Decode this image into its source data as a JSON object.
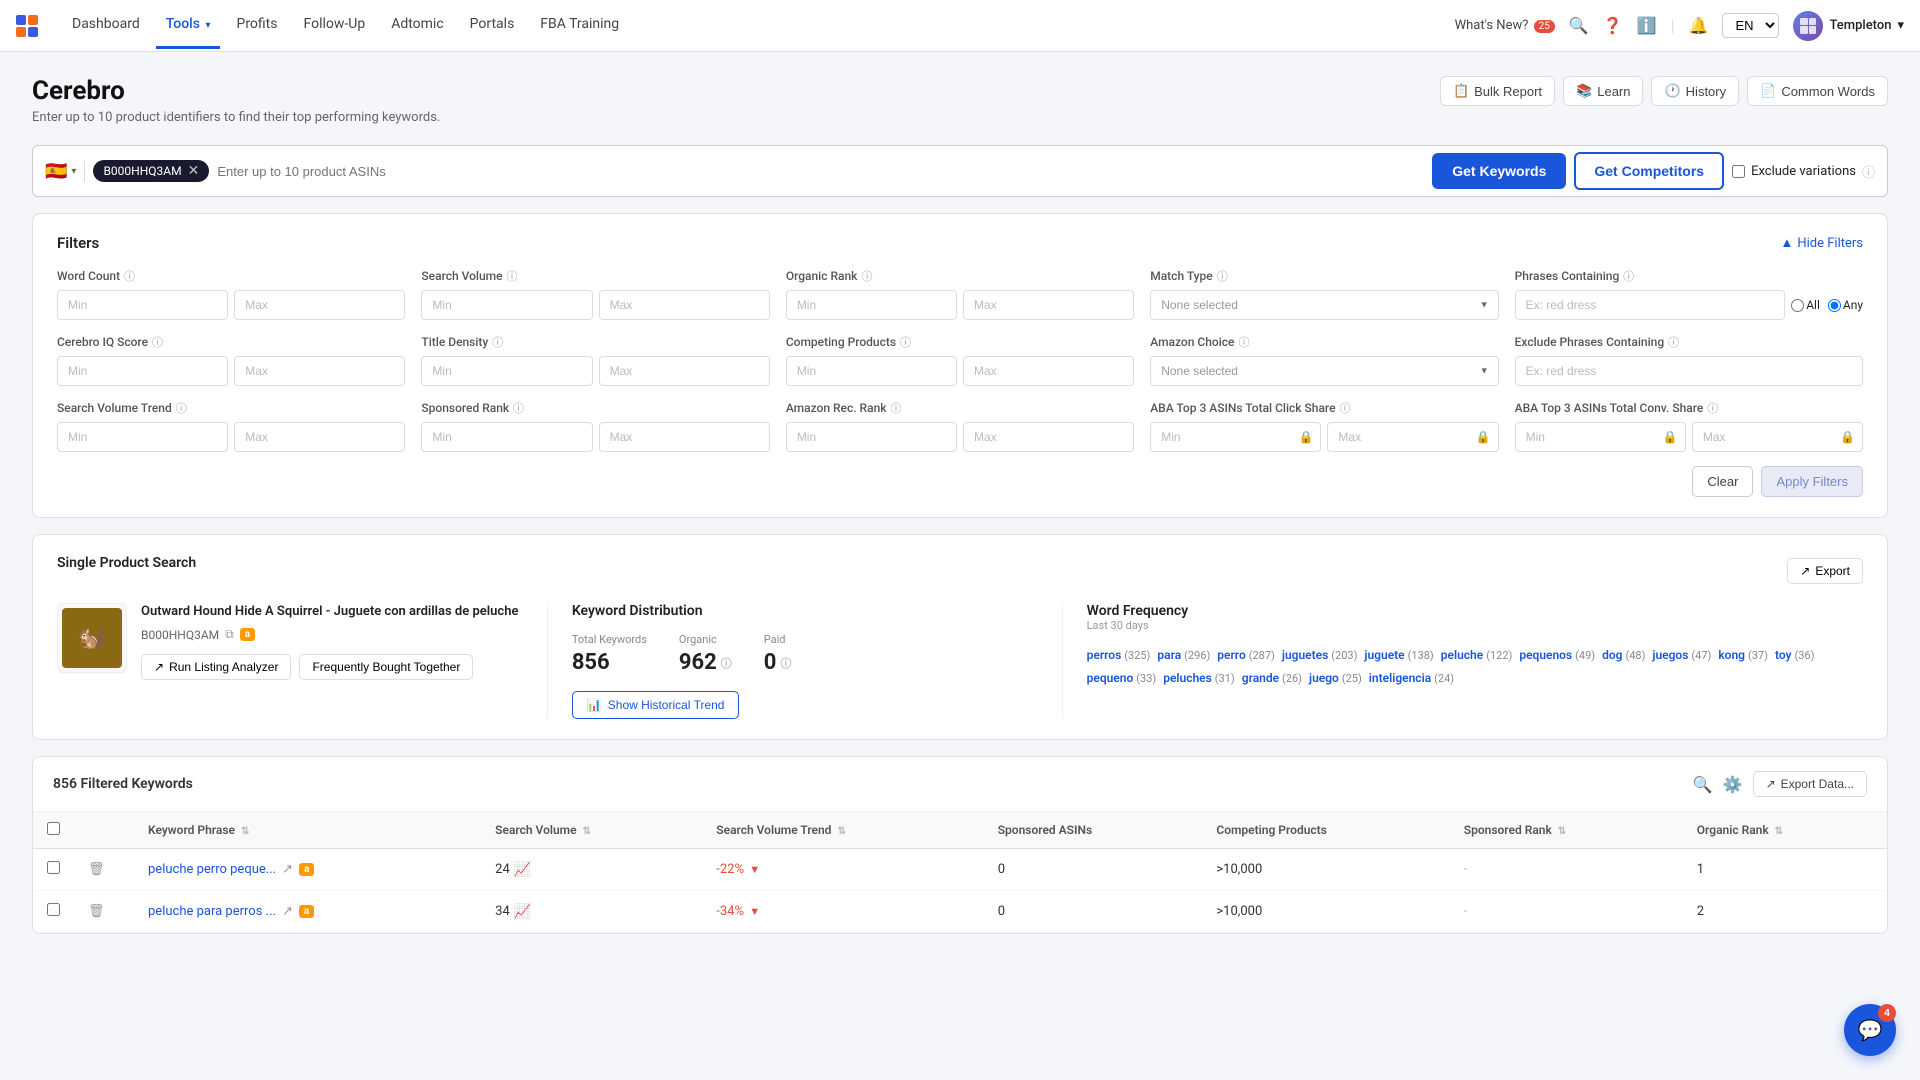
{
  "nav": {
    "items": [
      {
        "label": "Dashboard",
        "active": false
      },
      {
        "label": "Tools",
        "active": true,
        "caret": "▾"
      },
      {
        "label": "Profits",
        "active": false
      },
      {
        "label": "Follow-Up",
        "active": false
      },
      {
        "label": "Adtomic",
        "active": false
      },
      {
        "label": "Portals",
        "active": false
      },
      {
        "label": "FBA Training",
        "active": false
      }
    ],
    "whats_new": "What's New?",
    "badge": "25",
    "lang": "EN",
    "user": "Templeton"
  },
  "page": {
    "title": "Cerebro",
    "subtitle": "Enter up to 10 product identifiers to find their top performing keywords.",
    "actions": [
      {
        "label": "Bulk Report",
        "icon": "📋"
      },
      {
        "label": "Learn",
        "icon": "📚"
      },
      {
        "label": "History",
        "icon": "🕐"
      },
      {
        "label": "Common Words",
        "icon": "📄"
      }
    ]
  },
  "search": {
    "asin_tag": "B000HHQ3AM",
    "placeholder": "Enter up to 10 product ASINs",
    "get_keywords": "Get Keywords",
    "get_competitors": "Get Competitors",
    "exclude_label": "Exclude variations"
  },
  "filters": {
    "title": "Filters",
    "hide_label": "Hide Filters",
    "groups": [
      {
        "row": 1,
        "items": [
          {
            "label": "Word Count",
            "type": "minmax"
          },
          {
            "label": "Search Volume",
            "type": "minmax"
          },
          {
            "label": "Organic Rank",
            "type": "minmax"
          },
          {
            "label": "Match Type",
            "type": "select",
            "placeholder": "None selected"
          },
          {
            "label": "Phrases Containing",
            "type": "text_radio",
            "placeholder": "Ex: red dress"
          }
        ]
      },
      {
        "row": 2,
        "items": [
          {
            "label": "Cerebro IQ Score",
            "type": "minmax"
          },
          {
            "label": "Title Density",
            "type": "minmax"
          },
          {
            "label": "Competing Products",
            "type": "minmax"
          },
          {
            "label": "Amazon Choice",
            "type": "select",
            "placeholder": "None selected"
          },
          {
            "label": "Exclude Phrases Containing",
            "type": "text",
            "placeholder": "Ex: red dress"
          }
        ]
      },
      {
        "row": 3,
        "items": [
          {
            "label": "Search Volume Trend",
            "type": "minmax"
          },
          {
            "label": "Sponsored Rank",
            "type": "minmax"
          },
          {
            "label": "Amazon Rec. Rank",
            "type": "minmax"
          },
          {
            "label": "ABA Top 3 ASINs Total Click Share",
            "type": "minmax_locked"
          },
          {
            "label": "ABA Top 3 ASINs Total Conv. Share",
            "type": "minmax_locked"
          }
        ]
      }
    ],
    "clear_label": "Clear",
    "apply_label": "Apply Filters"
  },
  "product_section": {
    "title": "Single Product Search",
    "export_label": "Export",
    "product": {
      "name": "Outward Hound Hide A Squirrel - Juguete con ardillas de peluche",
      "asin": "B000HHQ3AM",
      "image_emoji": "🐿️"
    },
    "actions": [
      {
        "label": "Run Listing Analyzer",
        "icon": "↗"
      },
      {
        "label": "Frequently Bought Together"
      }
    ],
    "keyword_distribution": {
      "title": "Keyword Distribution",
      "total_label": "Total Keywords",
      "total_value": "856",
      "organic_label": "Organic",
      "organic_value": "962",
      "paid_label": "Paid",
      "paid_value": "0",
      "trend_btn": "Show Historical Trend"
    },
    "word_frequency": {
      "title": "Word Frequency",
      "subtitle": "Last 30 days",
      "words": [
        {
          "word": "perros",
          "count": "325"
        },
        {
          "word": "para",
          "count": "296"
        },
        {
          "word": "perro",
          "count": "287"
        },
        {
          "word": "juguetes",
          "count": "203"
        },
        {
          "word": "juguete",
          "count": "138"
        },
        {
          "word": "peluche",
          "count": "122"
        },
        {
          "word": "pequenos",
          "count": "49"
        },
        {
          "word": "dog",
          "count": "48"
        },
        {
          "word": "juegos",
          "count": "47"
        },
        {
          "word": "kong",
          "count": "37"
        },
        {
          "word": "toy",
          "count": "36"
        },
        {
          "word": "pequeno",
          "count": "33"
        },
        {
          "word": "peluches",
          "count": "31"
        },
        {
          "word": "grande",
          "count": "26"
        },
        {
          "word": "juego",
          "count": "25"
        },
        {
          "word": "inteligencia",
          "count": "24"
        }
      ]
    }
  },
  "table": {
    "count_label": "856 Filtered Keywords",
    "export_label": "Export Data...",
    "columns": [
      {
        "label": "Keyword Phrase",
        "sortable": true
      },
      {
        "label": "Search Volume",
        "sortable": true
      },
      {
        "label": "Search Volume Trend",
        "sortable": true
      },
      {
        "label": "Sponsored ASINs",
        "sortable": false
      },
      {
        "label": "Competing Products",
        "sortable": false
      },
      {
        "label": "Sponsored Rank",
        "sortable": true
      },
      {
        "label": "Organic Rank",
        "sortable": true
      }
    ],
    "rows": [
      {
        "phrase": "peluche perro peque...",
        "search_volume": "24",
        "sv_trend": "-22%",
        "trend_dir": "down",
        "sponsored_asins": "0",
        "competing_products": ">10,000",
        "sponsored_rank": "-",
        "organic_rank": "1"
      },
      {
        "phrase": "peluche para perros ...",
        "search_volume": "34",
        "sv_trend": "-34%",
        "trend_dir": "down",
        "sponsored_asins": "0",
        "competing_products": ">10,000",
        "sponsored_rank": "-",
        "organic_rank": "2"
      }
    ]
  },
  "chat": {
    "badge": "4"
  }
}
